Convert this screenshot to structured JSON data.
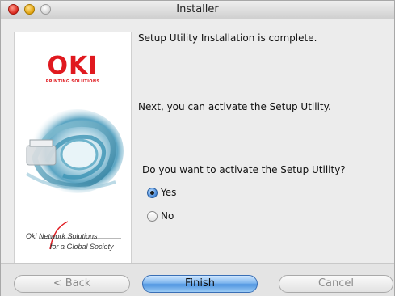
{
  "window": {
    "title": "Installer"
  },
  "sidepanel": {
    "logo": "OKI",
    "logo_subtitle": "PRINTING SOLUTIONS",
    "tagline_line1": "Oki  Network Solutions",
    "tagline_line2": "for a Global Society"
  },
  "main": {
    "complete_text": "Setup Utility Installation is complete.",
    "next_text": "Next, you can activate the Setup Utility.",
    "question": "Do you want to activate the Setup Utility?",
    "options": [
      {
        "label": "Yes",
        "selected": true
      },
      {
        "label": "No",
        "selected": false
      }
    ]
  },
  "buttons": {
    "back": "< Back",
    "finish": "Finish",
    "cancel": "Cancel"
  },
  "colors": {
    "brand_red": "#e0191f",
    "primary_button": "#4f95e0"
  }
}
